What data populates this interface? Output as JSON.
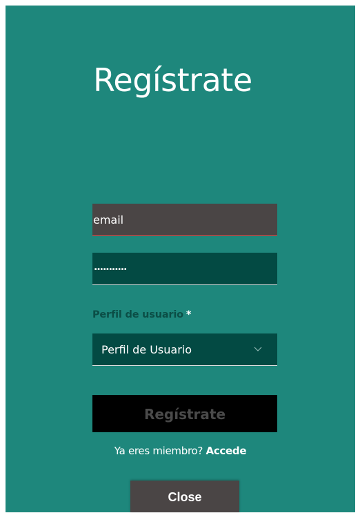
{
  "modal": {
    "title": "Regístrate",
    "background_color": "#1e877c"
  },
  "form": {
    "email": {
      "value": "email"
    },
    "password": {
      "value": "...........",
      "masked": true
    },
    "profile": {
      "label": "Perfil de usuario",
      "required_marker": "*",
      "selected_value": "Perfil de Usuario"
    },
    "submit_label": "Regístrate"
  },
  "footer": {
    "member_text": "Ya eres miembro?",
    "login_link": "Accede"
  },
  "close_label": "Close",
  "colors": {
    "accent": "#1e877c",
    "field_dark": "#034a43",
    "email_field": "#4a4545",
    "error_underline": "#d9534f",
    "button": "#000000"
  },
  "icons": {
    "select_indicator": "chevron-down-icon"
  }
}
